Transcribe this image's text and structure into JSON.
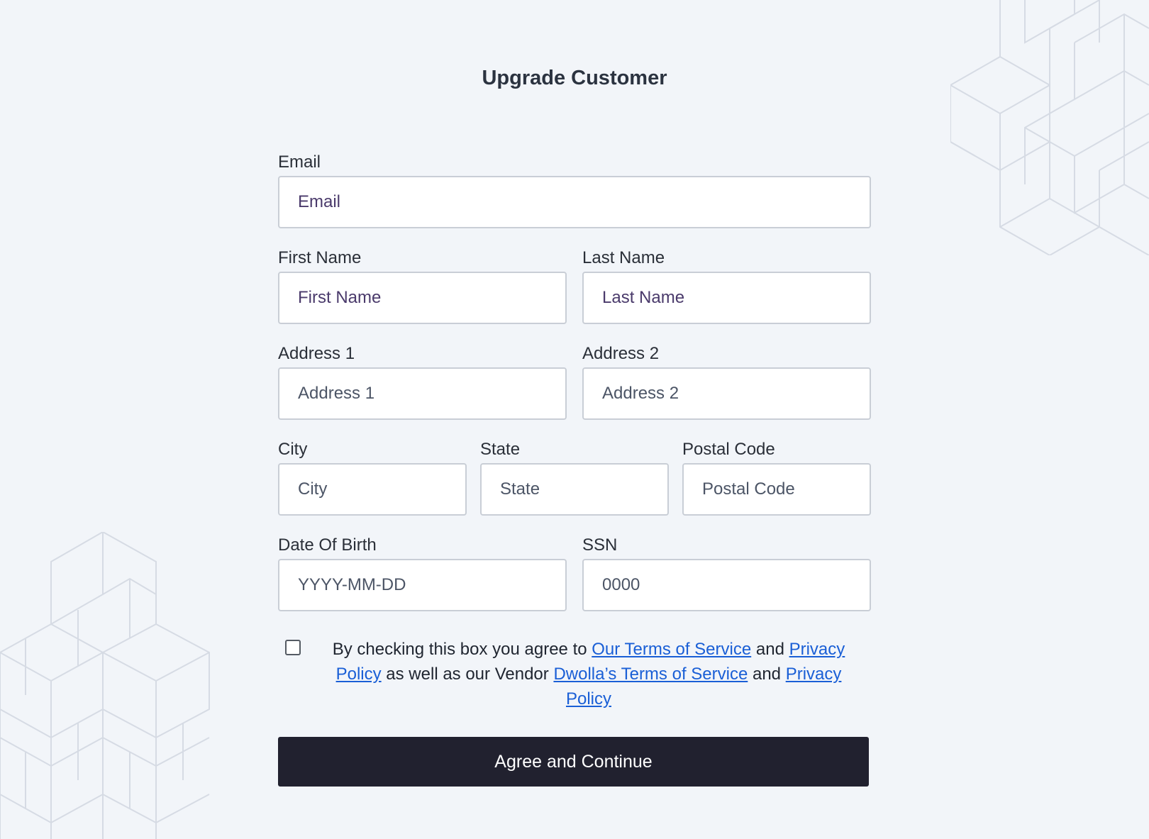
{
  "page": {
    "title": "Upgrade Customer"
  },
  "form": {
    "email": {
      "label": "Email",
      "placeholder": "Email"
    },
    "first_name": {
      "label": "First Name",
      "placeholder": "First Name"
    },
    "last_name": {
      "label": "Last Name",
      "placeholder": "Last Name"
    },
    "address1": {
      "label": "Address 1",
      "placeholder": "Address 1"
    },
    "address2": {
      "label": "Address 2",
      "placeholder": "Address 2"
    },
    "city": {
      "label": "City",
      "placeholder": "City"
    },
    "state": {
      "label": "State",
      "placeholder": "State"
    },
    "postal_code": {
      "label": "Postal Code",
      "placeholder": "Postal Code"
    },
    "dob": {
      "label": "Date Of Birth",
      "placeholder": "YYYY-MM-DD"
    },
    "ssn": {
      "label": "SSN",
      "placeholder": "0000"
    }
  },
  "consent": {
    "checked": false,
    "text_1": "By checking this box you agree to ",
    "link_our_terms": "Our Terms of Service",
    "text_and_1": " and ",
    "link_our_privacy": "Privacy Policy",
    "text_2": " as well as our Vendor ",
    "link_dwolla_terms": "Dwolla’s Terms of Service",
    "text_and_2": " and ",
    "link_dwolla_privacy": "Privacy Policy"
  },
  "submit": {
    "label": "Agree and Continue"
  },
  "colors": {
    "background": "#f2f5f9",
    "button": "#21212f",
    "link": "#1a5fd6",
    "input_border": "#c9ced6",
    "placeholder_accent": "#4a3a6b"
  }
}
